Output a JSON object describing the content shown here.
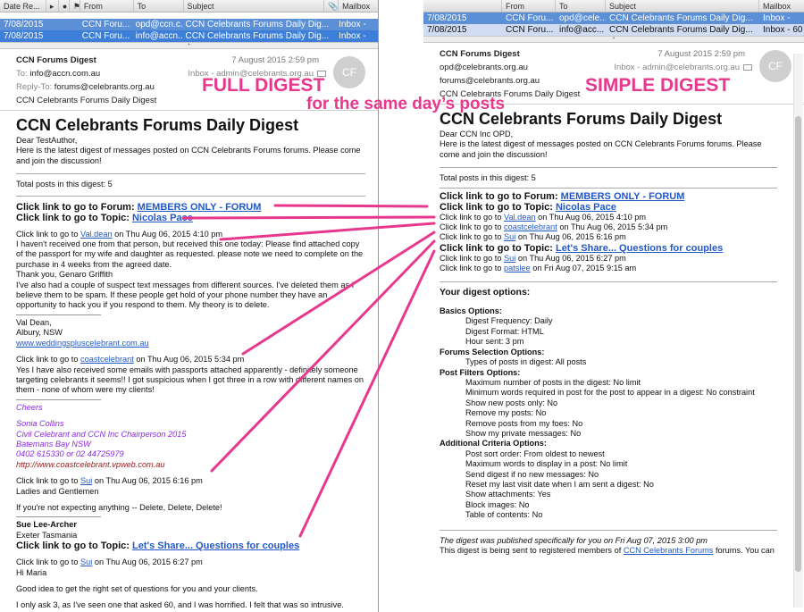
{
  "list_header": {
    "date": "Date Re...",
    "from": "From",
    "to": "To",
    "subject": "Subject",
    "mailbox": "Mailbox"
  },
  "left_list": [
    {
      "date": "7/08/2015",
      "from": "CCN Foru...",
      "to": "opd@ccn.c...",
      "subject": "CCN Celebrants Forums Daily Dig...",
      "mailbox": "Inbox -"
    },
    {
      "date": "7/08/2015",
      "from": "CCN Foru...",
      "to": "info@accn...",
      "subject": "CCN Celebrants Forums Daily Dig...",
      "mailbox": "Inbox -"
    }
  ],
  "right_list": [
    {
      "date": "7/08/2015",
      "from": "CCN Foru...",
      "to": "opd@cele...",
      "subject": "CCN Celebrants Forums Daily Dig...",
      "mailbox": "Inbox -"
    },
    {
      "date": "7/08/2015",
      "from": "CCN Foru...",
      "to": "info@acc...",
      "subject": "CCN Celebrants Forums Daily Dig...",
      "mailbox": "Inbox - 60"
    }
  ],
  "left_msg": {
    "from": "CCN Forums Digest",
    "date": "7 August 2015 2:59 pm",
    "to_label": "To:",
    "to": "info@accn.com.au",
    "mailbox": "Inbox - admin@celebrants.org.au",
    "reply_label": "Reply-To:",
    "reply_to": "forums@celebrants.org.au",
    "subject": "CCN Celebrants Forums Daily Digest",
    "avatar": "CF"
  },
  "right_msg": {
    "from": "CCN Forums Digest",
    "date": "7 August 2015 2:59 pm",
    "to": "opd@celebrants.org.au",
    "mailbox": "Inbox - admin@celebrants.org.au",
    "reply_to": "forums@celebrants.org.au",
    "subject": "CCN Celebrants Forums Daily Digest",
    "avatar": "CF"
  },
  "common": {
    "title": "CCN Celebrants Forums Daily Digest",
    "intro": "Here is the latest digest of messages posted on CCN Celebrants Forums forums. Please come and join the discussion!",
    "total": "Total posts in this digest: 5",
    "forum_prefix": "Click link to go to Forum:",
    "forum_name": "MEMBERS ONLY - FORUM",
    "topic_prefix": "Click link to go to Topic:",
    "topic1": "Nicolas Pace",
    "topic2": "Let's Share... Questions for couples",
    "post_prefix": "Click link to go to",
    "u1": "Val.dean",
    "d1": "on Thu Aug 06, 2015 4:10 pm",
    "u2": "coastcelebrant",
    "d2": "on Thu Aug 06, 2015 5:34 pm",
    "u3": "Sui",
    "d3": "on Thu Aug 06, 2015 6:16 pm",
    "u4": "Sui",
    "d4": "on Thu Aug 06, 2015 6:27 pm",
    "u5": "patslee",
    "d5": "on Fri Aug 07, 2015 9:15 am"
  },
  "left_body": {
    "greeting": "Dear TestAuthor,",
    "p1": "I haven't received one from that person, but received this one today: Please find attached copy of the passport for my wife and daughter as requested. please note we need to complete on the purchase in 4 weeks from the agreed date.",
    "p1b": "Thank you, Genaro Griffith",
    "p2": "I've also had a couple of suspect text messages from different sources. I've deleted them as I believe them to be spam. If these people get hold of your phone number they have an opportunity to hack you if you respond to them. My theory is to delete.",
    "sig1_name": "Val Dean,",
    "sig1_loc": "Albury, NSW",
    "sig1_link": "www.weddingsplusceIebrant.com.au",
    "p3": "Yes I have also received some emails with passports attached apparently - definitely someone targeting celebrants it seems!! I got suspicious when I got three in a row with different names on them - none of whom were my clients!",
    "cheers": "Cheers",
    "sig2_name": "Sonia Collins",
    "sig2_title": "Civil Celebrant and CCN Inc Chairperson 2015",
    "sig2_loc": "Batemans Bay NSW",
    "sig2_phone": "0402 615330 or 02 44725979",
    "sig2_link": "http://www.coastcelebrant.vpweb.com.au",
    "ladies": "Ladies and Gentlemen",
    "delete": "If you're not expecting anything -- Delete, Delete, Delete!",
    "sig3_name": "Sue Lee-Archer",
    "sig3_loc": "Exeter Tasmania",
    "hi": "Hi Maria",
    "p4": "Good idea to get the right set of questions for you and your clients.",
    "p5": "I only ask 3, as I've seen one that asked 60, and I was horrified. I felt that was so intrusive."
  },
  "right_body": {
    "greeting": "Dear CCN Inc OPD,",
    "options_title": "Your digest options:",
    "basics_h": "Basics Options:",
    "basics": [
      "Digest Frequency: Daily",
      "Digest Format: HTML",
      "Hour sent: 3 pm"
    ],
    "forums_h": "Forums Selection Options:",
    "forums": [
      "Types of posts in digest: All posts"
    ],
    "filters_h": "Post Filters Options:",
    "filters": [
      "Maximum number of posts in the digest: No limit",
      "Minimum words required in post for the post to appear in a digest: No constraint",
      "Show new posts only: No",
      "Remove my posts: No",
      "Remove posts from my foes: No",
      "Show my private messages: No"
    ],
    "criteria_h": "Additional Criteria Options:",
    "criteria": [
      "Post sort order: From oldest to newest",
      "Maximum words to display in a post: No limit",
      "Send digest if no new messages: No",
      "Reset my last visit date when I am sent a digest: No",
      "Show attachments: Yes",
      "Block images: No",
      "Table of contents: No"
    ],
    "footer1": "The digest was published specifically for you on Fri Aug 07, 2015 3:00 pm",
    "footer2_a": "This digest is being sent to registered members of",
    "footer2_link": "CCN Celebrants Forums",
    "footer2_b": "forums. You can"
  },
  "annotations": {
    "full": "FULL DIGEST",
    "simple": "SIMPLE DIGEST",
    "same_day": "for the same day’s posts",
    "color": "#e8388e"
  }
}
